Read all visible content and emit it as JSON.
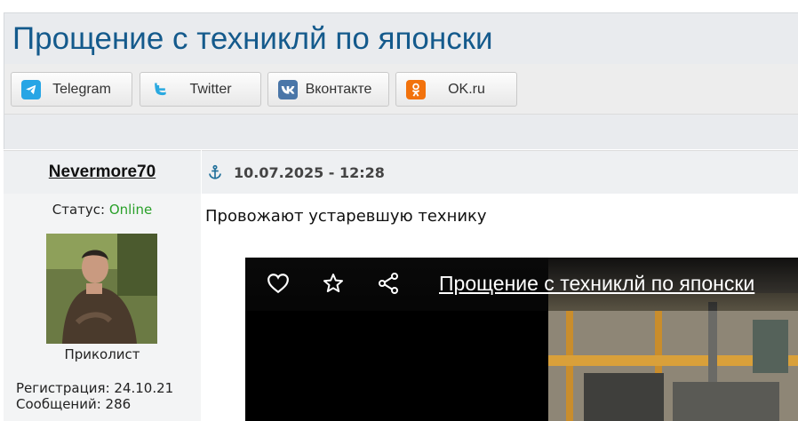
{
  "topic": {
    "title": "Прощение с техниклй по японски"
  },
  "share": {
    "buttons": [
      {
        "label": "Telegram",
        "icon": "telegram-icon",
        "color": "#27a5e5"
      },
      {
        "label": "Twitter",
        "icon": "twitter-icon",
        "color": "#1da1f2"
      },
      {
        "label": "Вконтакте",
        "icon": "vk-icon",
        "color": "#4a76a8"
      },
      {
        "label": "OK.ru",
        "icon": "odnoklassniki-icon",
        "color": "#f2720c"
      }
    ]
  },
  "post": {
    "author": "Nevermore70",
    "date": "10.07.2025 - 12:28",
    "status_label": "Статус:",
    "status_value": "Online",
    "rank": "Приколист",
    "registration": "Регистрация: 24.10.21",
    "messages": "Сообщений: 286",
    "text": "Провожают устаревшую технику",
    "video": {
      "title": "Прощение с техниклй по японски",
      "buttons": [
        "like-icon",
        "favorite-icon",
        "share-icon"
      ]
    }
  },
  "colors": {
    "title": "#145a8c",
    "online": "#2aa02a",
    "anchor": "#1f6f9a"
  }
}
